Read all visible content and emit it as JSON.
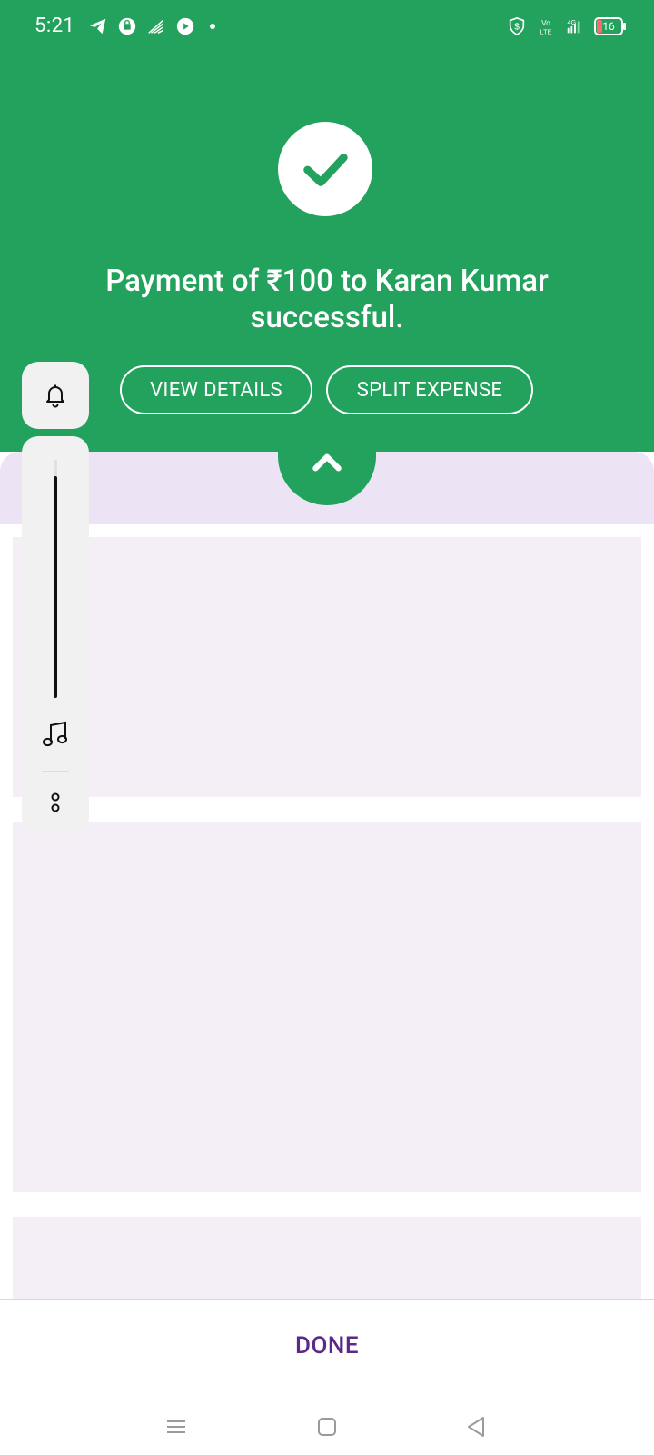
{
  "status_bar": {
    "time": "5:21",
    "battery_level": "16",
    "left_icons": [
      "telegram-icon",
      "bag-icon",
      "cast-icon",
      "play-icon",
      "dot-icon"
    ],
    "right_icons": [
      "shield-dollar-icon",
      "volte-icon",
      "signal-4g-icon",
      "battery-icon"
    ]
  },
  "header": {
    "success_message": "Payment of ₹100 to Karan Kumar successful.",
    "buttons": {
      "view_details": "VIEW DETAILS",
      "split_expense": "SPLIT EXPENSE"
    }
  },
  "volume_panel": {
    "level_fraction": 0.93
  },
  "footer": {
    "done_label": "DONE"
  },
  "colors": {
    "primary_green": "#23A25D",
    "accent_purple": "#5B2A86",
    "card_bg": "#F4EEF7",
    "band_lavender": "#ECE4F5"
  }
}
